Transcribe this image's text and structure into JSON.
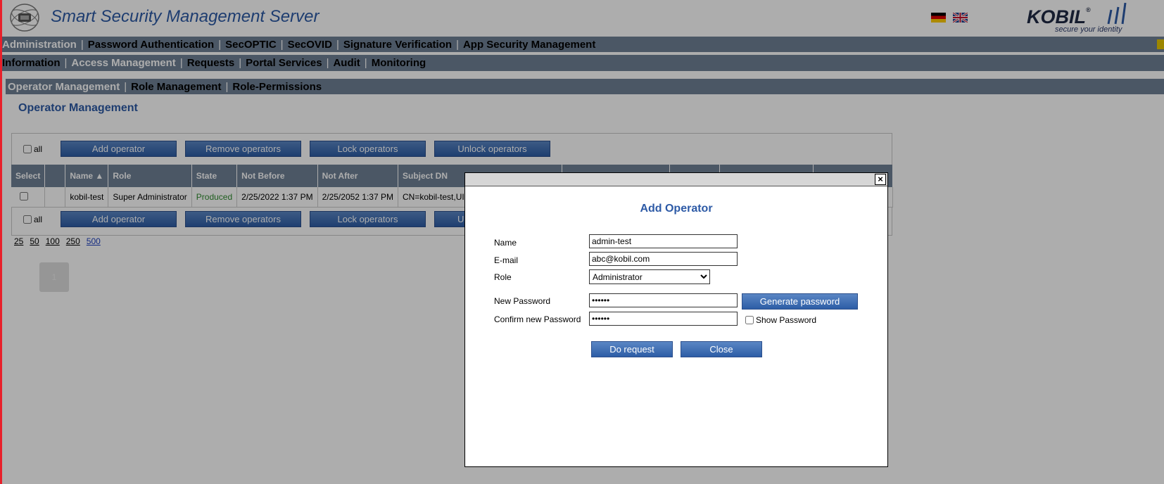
{
  "header": {
    "app_title": "Smart Security Management Server",
    "brand": "KOBIL",
    "brand_mark": "®",
    "brand_tagline": "secure your identity"
  },
  "nav_main": [
    "Administration",
    "Password Authentication",
    "SecOPTIC",
    "SecOVID",
    "Signature Verification",
    "App Security Management"
  ],
  "nav_sub": [
    "Information",
    "Access Management",
    "Requests",
    "Portal Services",
    "Audit",
    "Monitoring"
  ],
  "nav_third": [
    "Operator Management",
    "Role Management",
    "Role-Permissions"
  ],
  "page_heading": "Operator Management",
  "toolbar": {
    "all_label": "all",
    "add": "Add operator",
    "remove": "Remove operators",
    "lock": "Lock operators",
    "unlock": "Unlock operators",
    "unlock_partial": "U"
  },
  "table": {
    "headers": [
      "Select",
      "",
      "Name ▲",
      "Role",
      "State",
      "Not Before",
      "Not After",
      "Subject DN"
    ],
    "rows": [
      {
        "name": "kobil-test",
        "role": "Super Administrator",
        "state": "Produced",
        "not_before": "2/25/2022 1:37 PM",
        "not_after": "2/25/2052 1:37 PM",
        "subject_dn": "CN=kobil-test,UID"
      }
    ]
  },
  "pager": {
    "sizes": [
      "25",
      "50",
      "100",
      "250",
      "500"
    ],
    "current_size": "500",
    "page": "1"
  },
  "colors": {
    "accent": "#2d5aa6",
    "nav": "#6f8196",
    "produced": "#2e8b2e"
  },
  "modal": {
    "close_glyph": "×",
    "title": "Add Operator",
    "name_label": "Name",
    "name_value": "admin-test",
    "email_label": "E-mail",
    "email_value": "abc@kobil.com",
    "role_label": "Role",
    "role_value": "Administrator",
    "new_password_label": "New Password",
    "new_password_value": "••••••",
    "confirm_password_label": "Confirm new Password",
    "confirm_password_value": "••••••",
    "generate_button": "Generate password",
    "show_password_label": "Show Password",
    "do_request_button": "Do request",
    "close_button": "Close"
  }
}
